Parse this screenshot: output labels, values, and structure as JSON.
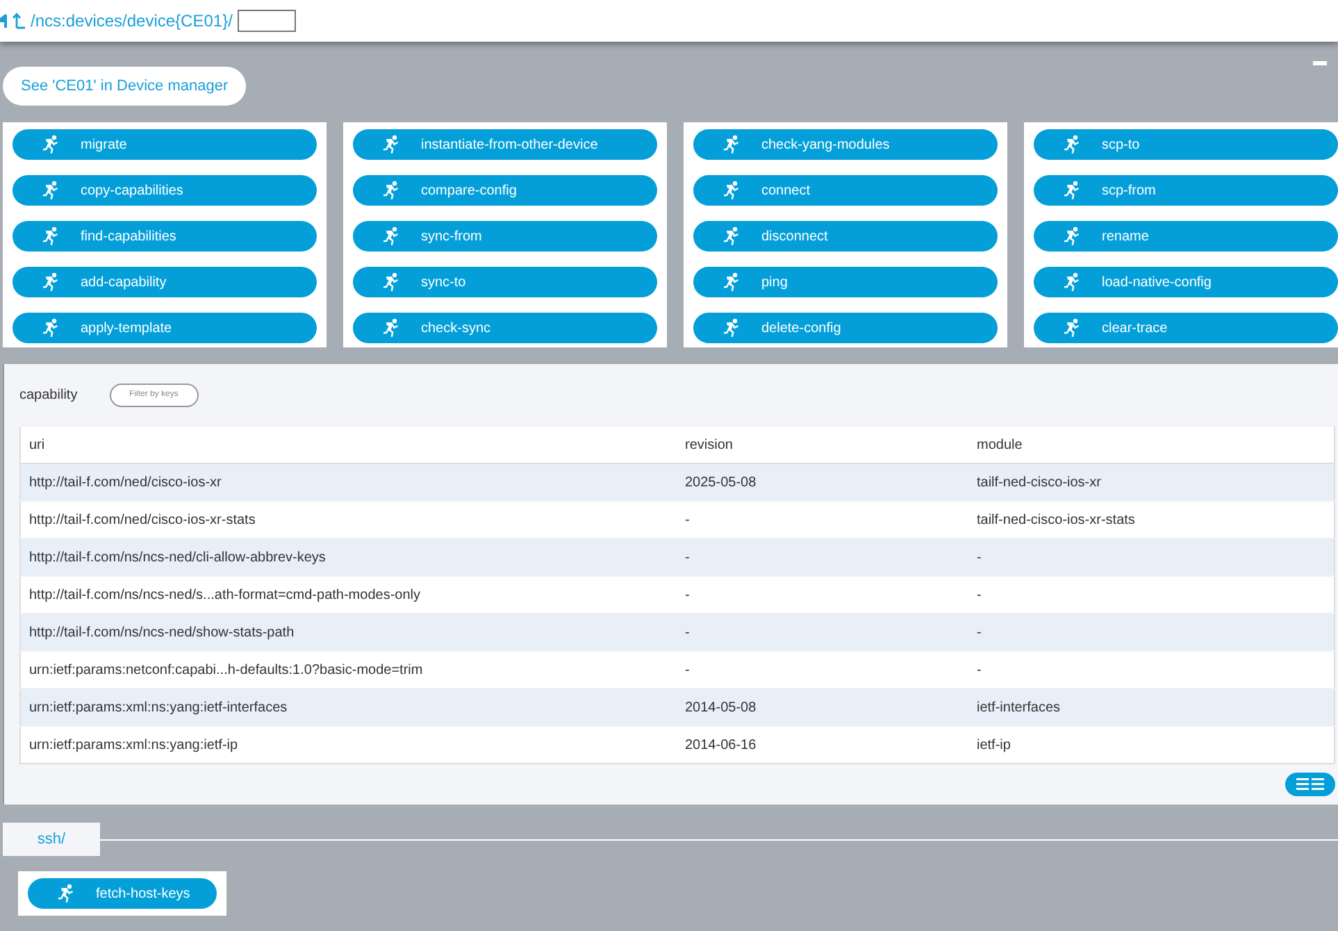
{
  "breadcrumb": {
    "path": "/ncs:devices/device{CE01}/"
  },
  "device_manager_link": "See 'CE01' in Device manager",
  "action_groups": [
    {
      "actions": [
        "migrate",
        "copy-capabilities",
        "find-capabilities",
        "add-capability",
        "apply-template"
      ]
    },
    {
      "actions": [
        "instantiate-from-other-device",
        "compare-config",
        "sync-from",
        "sync-to",
        "check-sync"
      ]
    },
    {
      "actions": [
        "check-yang-modules",
        "connect",
        "disconnect",
        "ping",
        "delete-config"
      ]
    },
    {
      "actions": [
        "scp-to",
        "scp-from",
        "rename",
        "load-native-config",
        "clear-trace"
      ]
    }
  ],
  "capability": {
    "title": "capability",
    "filter": {
      "placeholder": "Filter by keys"
    },
    "columns": [
      "uri",
      "revision",
      "module"
    ],
    "rows": [
      [
        "http://tail-f.com/ned/cisco-ios-xr",
        "2025-05-08",
        "tailf-ned-cisco-ios-xr"
      ],
      [
        "http://tail-f.com/ned/cisco-ios-xr-stats",
        "-",
        "tailf-ned-cisco-ios-xr-stats"
      ],
      [
        "http://tail-f.com/ns/ncs-ned/cli-allow-abbrev-keys",
        "-",
        "-"
      ],
      [
        "http://tail-f.com/ns/ncs-ned/s...ath-format=cmd-path-modes-only",
        "-",
        "-"
      ],
      [
        "http://tail-f.com/ns/ncs-ned/show-stats-path",
        "-",
        "-"
      ],
      [
        "urn:ietf:params:netconf:capabi...h-defaults:1.0?basic-mode=trim",
        "-",
        "-"
      ],
      [
        "urn:ietf:params:xml:ns:yang:ietf-interfaces",
        "2014-05-08",
        "ietf-interfaces"
      ],
      [
        "urn:ietf:params:xml:ns:yang:ietf-ip",
        "2014-06-16",
        "ietf-ip"
      ]
    ]
  },
  "ssh": {
    "tab": "ssh/",
    "actions": [
      "fetch-host-keys"
    ]
  }
}
